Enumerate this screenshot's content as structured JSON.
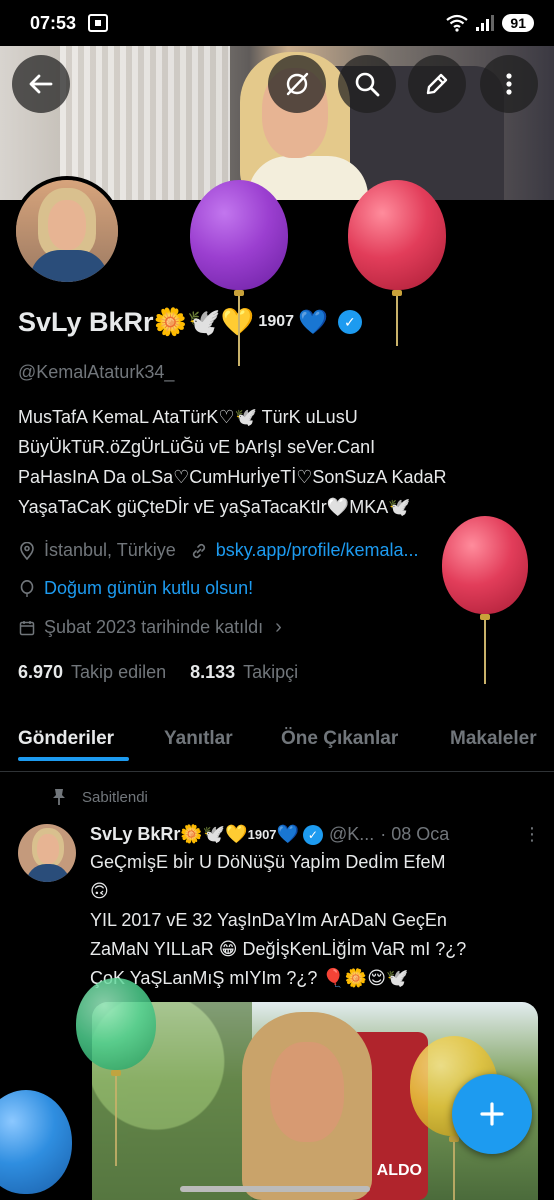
{
  "status": {
    "time": "07:53",
    "battery": "91"
  },
  "profile": {
    "name": "SvLy BkRr🌼🕊️💛",
    "name_suffix": "1907",
    "name_heart": "💙",
    "handle": "@KemalAtaturk34_",
    "bio": "MusTafA KemaL AtaTürK♡🕊️ TürK uLusU\nBüyÜkTüR.öZgÜrLüĞü vE bArIşI seVer.CanI\nPaHasInA Da oLSa♡CumHurİyeTİ♡SonSuzA KadaR\nYaşaTaCaK güÇteDİr vE yaŞaTacaKtIr🤍MKA🕊️",
    "location": "İstanbul, Türkiye",
    "website": "bsky.app/profile/kemala...",
    "birthday": "Doğum günün kutlu olsun!",
    "joined": "Şubat 2023 tarihinde katıldı",
    "following_count": "6.970",
    "following_label": "Takip edilen",
    "followers_count": "8.133",
    "followers_label": "Takipçi"
  },
  "tabs": [
    {
      "label": "Gönderiler",
      "active": true
    },
    {
      "label": "Yanıtlar",
      "active": false
    },
    {
      "label": "Öne Çıkanlar",
      "active": false
    },
    {
      "label": "Makaleler",
      "active": false
    }
  ],
  "post": {
    "pinned_label": "Sabitlendi",
    "author": "SvLy BkRr🌼🕊️💛",
    "author_suffix": "1907",
    "author_heart": "💙",
    "handle": "@K...",
    "date": "· 08 Oca",
    "text": "GeÇmİşE bİr U DöNüŞü Yapİm Dedİm EfeM\n🙃\nYIL 2017 vE 32 YaşInDaYIm ArADaN GeçEn\nZaMaN YILLaR 😁 DeğİşKenLİğİm VaR mI ?¿?\nÇoK YaŞLanMıŞ mIYIm ?¿? 🎈🌼😌🕊️",
    "media_text": "ALDO"
  },
  "icons": {
    "back": "back-arrow-icon",
    "grok": "grok-icon",
    "search": "search-icon",
    "edit": "edit-icon",
    "more": "more-vertical-icon",
    "location": "location-pin-icon",
    "link": "link-icon",
    "balloon": "balloon-icon",
    "calendar": "calendar-icon",
    "pin": "pin-icon",
    "compose": "plus-icon"
  },
  "colors": {
    "accent": "#1d9bf0",
    "balloon_purple": "#9b3fd0",
    "balloon_red": "#e23d5a",
    "balloon_green": "#4fd08f",
    "balloon_yellow": "#e9c53a",
    "balloon_blue": "#2f8ee0"
  }
}
